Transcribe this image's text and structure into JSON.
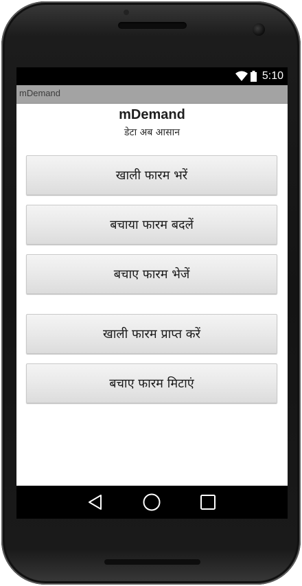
{
  "status_bar": {
    "time": "5:10",
    "icons": [
      "wifi-icon",
      "battery-icon"
    ]
  },
  "action_bar": {
    "title": "mDemand"
  },
  "header": {
    "title": "mDemand",
    "subtitle": "डेटा अब आसान"
  },
  "buttons": [
    {
      "label": "खाली फारम भरें"
    },
    {
      "label": "बचाया फारम बदलें"
    },
    {
      "label": "बचाए फारम भेजें"
    },
    {
      "label": "खाली फारम प्राप्त करें"
    },
    {
      "label": "बचाए फारम मिटाएं"
    }
  ],
  "nav_bar": {
    "icons": [
      "back-icon",
      "home-icon",
      "recents-icon"
    ]
  },
  "colors": {
    "status_bar": "#000000",
    "title_bar": "#a3a3a3",
    "button_face": "#e9e9e9",
    "device_body": "#1c1c1c"
  }
}
